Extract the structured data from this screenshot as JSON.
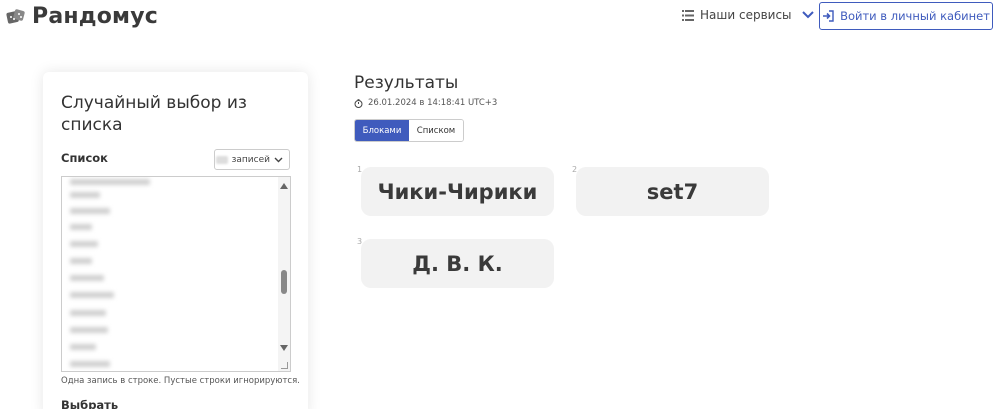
{
  "header": {
    "logo_text": "Рандомус",
    "services_label": "Наши сервисы",
    "login_label": "Войти в личный кабинет"
  },
  "card": {
    "title": "Случайный выбор из списка",
    "list_label": "Список",
    "records_label": "записей",
    "hint": "Одна запись в строке. Пустые строки игнорируются.",
    "pick_label": "Выбрать"
  },
  "results": {
    "title": "Результаты",
    "timestamp": "26.01.2024 в 14:18:41 UTC+3",
    "view_blocks": "Блоками",
    "view_list": "Списком",
    "items": [
      {
        "num": "1",
        "value": "Чики-Чирики"
      },
      {
        "num": "2",
        "value": "set7"
      },
      {
        "num": "3",
        "value": "Д. В. К."
      }
    ]
  },
  "colors": {
    "accent": "#3f5bbd",
    "block_bg": "#f2f2f2"
  },
  "icons": {
    "logo": "dice-icon",
    "services": "list-icon",
    "services_chevron": "chevron-down-icon",
    "login": "sign-in-icon",
    "records_chevron": "chevron-down-icon",
    "timestamp": "stopwatch-icon"
  }
}
